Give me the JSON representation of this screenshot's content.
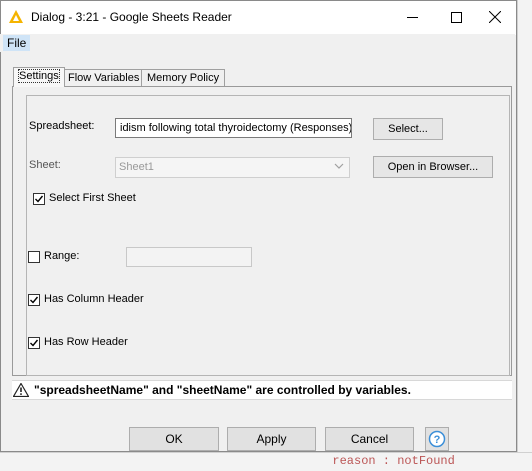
{
  "window": {
    "title": "Dialog - 3:21 - Google Sheets Reader"
  },
  "menu": {
    "file": "File"
  },
  "tabs": [
    {
      "label": "Settings",
      "active": true
    },
    {
      "label": "Flow Variables",
      "active": false
    },
    {
      "label": "Memory Policy",
      "active": false
    }
  ],
  "settings": {
    "spreadsheet_label": "Spreadsheet:",
    "spreadsheet_value": "idism following total thyroidectomy (Responses)",
    "select_button": "Select...",
    "sheet_label": "Sheet:",
    "sheet_value": "Sheet1",
    "open_browser_button": "Open in Browser...",
    "select_first_sheet_label": "Select First Sheet",
    "select_first_sheet_checked": true,
    "range_label": "Range:",
    "range_checked": false,
    "range_value": "",
    "has_column_header_label": "Has Column Header",
    "has_column_header_checked": true,
    "has_row_header_label": "Has Row Header",
    "has_row_header_checked": true
  },
  "status": {
    "message": "\"spreadsheetName\" and \"sheetName\" are controlled by variables."
  },
  "buttons": {
    "ok": "OK",
    "apply": "Apply",
    "cancel": "Cancel"
  },
  "background": {
    "fragment": "  reason : notFound"
  },
  "icons": {
    "app": "knime-triangle-icon",
    "warning": "warning-icon",
    "help": "help-icon"
  },
  "colors": {
    "app_icon": "#f5b400",
    "help_icon": "#3c8fd8",
    "menu_highlight": "#cfe4f7"
  }
}
